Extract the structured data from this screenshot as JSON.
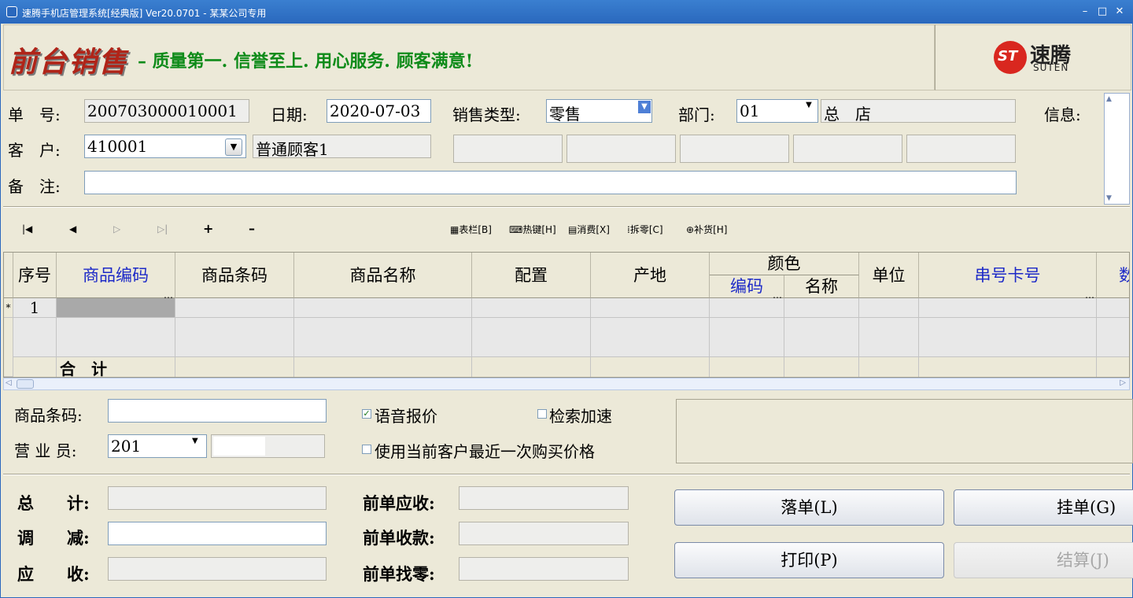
{
  "window": {
    "title": "速腾手机店管理系统[经典版] Ver20.0701 - 某某公司专用"
  },
  "banner": {
    "heading": "前台销售",
    "slogan": "– 质量第一. 信誉至上. 用心服务. 顾客满意!"
  },
  "logo": {
    "name": "速腾",
    "sub": "SUTEN"
  },
  "header": {
    "order_no_label": "单　号:",
    "order_no": "200703000010001",
    "date_label": "日期:",
    "date": "2020-07-03",
    "sale_type_label": "销售类型:",
    "sale_type": "零售",
    "dept_label": "部门:",
    "dept_code": "01",
    "dept_name": "总　店",
    "info_label": "信息:",
    "customer_label": "客　户:",
    "customer_code": "410001",
    "customer_name": "普通顾客1",
    "remark_label": "备　注:",
    "remark": ""
  },
  "toolbar": {
    "grid_cols": "表栏[B]",
    "hotkey": "热键[H]",
    "consume": "消费[X]",
    "split": "拆零[C]",
    "restock": "补货[H]"
  },
  "grid": {
    "headers": {
      "seq": "序号",
      "code": "商品编码",
      "barcode": "商品条码",
      "name": "商品名称",
      "config": "配置",
      "origin": "产地",
      "color": "颜色",
      "color_code": "编码",
      "color_name": "名称",
      "unit": "单位",
      "serial": "串号卡号",
      "qty": "数"
    },
    "rows": [
      {
        "marker": "*",
        "seq": "1"
      }
    ],
    "total_label": "合　计"
  },
  "entry": {
    "barcode_label": "商品条码:",
    "staff_label": "营 业 员:",
    "staff_code": "201",
    "voice_label": "语音报价",
    "voice_checked": true,
    "search_label": "检索加速",
    "search_checked": false,
    "lastprice_label": "使用当前客户最近一次购买价格",
    "lastprice_checked": false
  },
  "totals": {
    "total_label": "总　　计:",
    "adjust_label": "调　　减:",
    "receivable_label": "应　　收:",
    "prev_recv_label": "前单应收:",
    "prev_paid_label": "前单收款:",
    "prev_change_label": "前单找零:"
  },
  "buttons": {
    "post": "落单(L)",
    "hold": "挂单(G)",
    "print": "打印(P)",
    "settle": "结算(J)"
  },
  "colors": {
    "title_bar": "#2a68bd",
    "banner_red": "#b02418",
    "slogan_green": "#0e8b19",
    "header_blue": "#1c29c7"
  }
}
